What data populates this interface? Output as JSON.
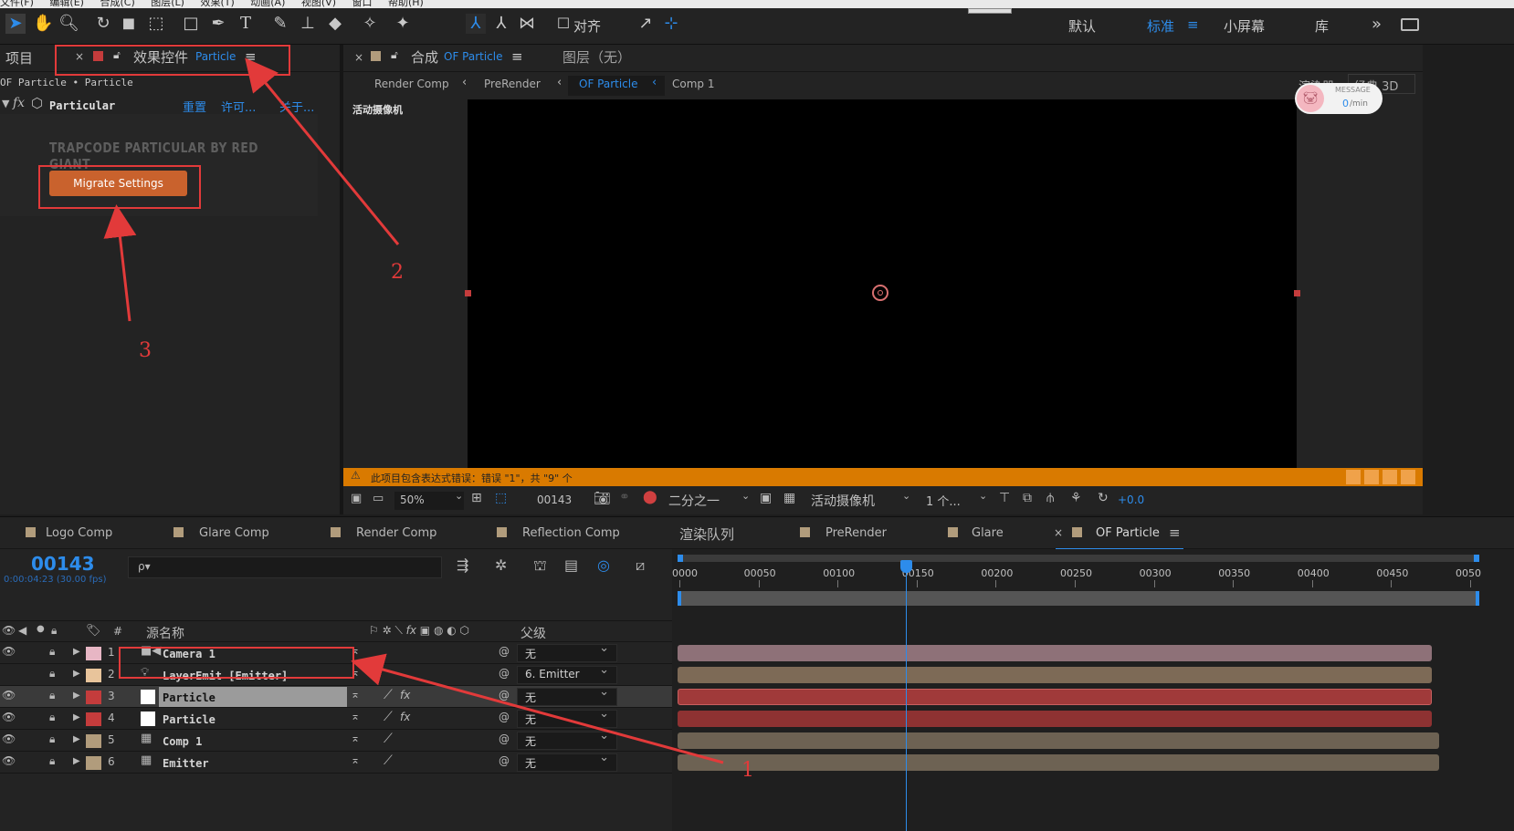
{
  "menu": [
    "文件(F)",
    "编辑(E)",
    "合成(C)",
    "图层(L)",
    "效果(T)",
    "动画(A)",
    "视图(V)",
    "窗口",
    "帮助(H)"
  ],
  "toolbar": {
    "snap_label": "对齐",
    "workspaces": [
      "默认",
      "标准",
      "小屏幕",
      "库"
    ],
    "active_workspace": "标准",
    "more": "»"
  },
  "left_panel": {
    "project_tab": "项目",
    "effects_tab_close": "×",
    "effects_tab_label": "效果控件",
    "effects_tab_layer": "Particle",
    "breadcrumb": "OF Particle • Particle",
    "fx_label": "fx",
    "effect_name": "Particular",
    "reset": "重置",
    "license": "许可...",
    "about": "关于...",
    "plugin_banner": "TRAPCODE PARTICULAR BY RED GIANT",
    "migrate_button": "Migrate Settings"
  },
  "comp_panel": {
    "close": "×",
    "tab_label": "合成",
    "tab_comp": "OF Particle",
    "layer_tab": "图层（无）",
    "flow": [
      "Render Comp",
      "PreRender",
      "OF Particle",
      "Comp 1"
    ],
    "active_flow": "OF Particle",
    "renderer": "渲染器",
    "renderer_mode": "经典 3D",
    "camera_label": "活动摄像机",
    "message_title": "MESSAGE",
    "message_value": "0",
    "message_unit": "/min",
    "warning_text": "此项目包含表达式错误：错误 \"1\"，共 \"9\" 个",
    "zoom": "50%",
    "timecode": "00143",
    "resolution": "二分之一",
    "view": "活动摄像机",
    "views_count": "1 个...",
    "exposure": "+0.0"
  },
  "timeline": {
    "tabs": [
      {
        "label": "Logo Comp",
        "color": "#b19c7c"
      },
      {
        "label": "Glare Comp",
        "color": "#b19c7c"
      },
      {
        "label": "Render Comp",
        "color": "#b19c7c"
      },
      {
        "label": "Reflection Comp",
        "color": "#b19c7c"
      },
      {
        "label": "渲染队列",
        "color": ""
      },
      {
        "label": "PreRender",
        "color": "#b19c7c"
      },
      {
        "label": "Glare",
        "color": "#b19c7c"
      },
      {
        "label": "OF Particle",
        "color": "#b19c7c"
      }
    ],
    "active_tab": "OF Particle",
    "close": "×",
    "current_frame": "00143",
    "current_time": "0:00:04:23 (30.00 fps)",
    "search_placeholder": "ρ▾",
    "col_number": "#",
    "col_source": "源名称",
    "col_parent": "父级",
    "ruler_ticks": [
      "0000",
      "00050",
      "00100",
      "00150",
      "00200",
      "00250",
      "00300",
      "00350",
      "00400",
      "00450",
      "0050"
    ],
    "playhead_frame": 143,
    "frame_range": [
      0,
      500
    ],
    "layers": [
      {
        "num": "1",
        "name": "Camera 1",
        "label_color": "#e7b6c4",
        "type": "camera",
        "parent": "无",
        "bar_color": "#8e7178",
        "selected": false
      },
      {
        "num": "2",
        "name": "LayerEmit [Emitter]",
        "label_color": "#e8c49b",
        "type": "light",
        "parent": "6. Emitter",
        "bar_color": "#7d6a56",
        "selected": false
      },
      {
        "num": "3",
        "name": "Particle",
        "label_color": "#c43c3c",
        "type": "solid",
        "parent": "无",
        "bar_color": "#a03a3a",
        "selected": true
      },
      {
        "num": "4",
        "name": "Particle",
        "label_color": "#c43c3c",
        "type": "solid",
        "parent": "无",
        "bar_color": "#8e3232",
        "selected": false
      },
      {
        "num": "5",
        "name": "Comp 1",
        "label_color": "#b19c7c",
        "type": "comp",
        "parent": "无",
        "bar_color": "#6d6253",
        "selected": false
      },
      {
        "num": "6",
        "name": "Emitter",
        "label_color": "#b19c7c",
        "type": "comp",
        "parent": "无",
        "bar_color": "#6d6253",
        "selected": false
      }
    ]
  },
  "annotations": [
    "1",
    "2",
    "3"
  ],
  "colors": {
    "accent": "#2d8ceb",
    "warning": "#d97a00",
    "annotation": "#e23a3a",
    "migrate": "#c9622d"
  }
}
